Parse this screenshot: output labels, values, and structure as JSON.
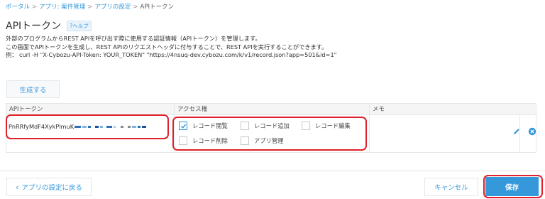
{
  "breadcrumb": {
    "portal": "ポータル",
    "separator": ">",
    "app_prefix": "アプリ: ",
    "app_name": "案件管理",
    "settings": "アプリの設定",
    "current": "APIトークン"
  },
  "header": {
    "title": "APIトークン",
    "help": "?ヘルプ"
  },
  "description": {
    "line1": "外部のプログラムからREST APIを呼び出す際に使用する認証情報（APIトークン）を管理します。",
    "line2": "この画面でAPIトークンを生成し、REST APIのリクエストヘッダに付与することで、REST APIを実行することができます。",
    "line3": "例： curl -H \"X-Cybozu-API-Token: YOUR_TOKEN\" \"https://4nsuq-dev.cybozu.com/k/v1/record.json?app=501&id=1\""
  },
  "generate_button": "生成する",
  "table": {
    "headers": {
      "token": "APIトークン",
      "access": "アクセス権",
      "memo": "メモ"
    },
    "row": {
      "token_prefix": "PnRRfyMdF4XykPlmuK",
      "memo": "",
      "permissions": [
        {
          "label": "レコード閲覧",
          "checked": true
        },
        {
          "label": "レコード追加",
          "checked": false
        },
        {
          "label": "レコード編集",
          "checked": false
        },
        {
          "label": "レコード削除",
          "checked": false
        },
        {
          "label": "アプリ管理",
          "checked": false
        }
      ]
    }
  },
  "icons": {
    "edit": "pencil-icon",
    "remove": "remove-circle-icon",
    "check": "check-icon",
    "back": "chevron-left-icon"
  },
  "footer": {
    "back": "アプリの設定に戻る",
    "cancel": "キャンセル",
    "save": "保存"
  },
  "colors": {
    "accent": "#3498db",
    "highlight": "#e0202a",
    "header_bg": "#f5f5f5"
  }
}
